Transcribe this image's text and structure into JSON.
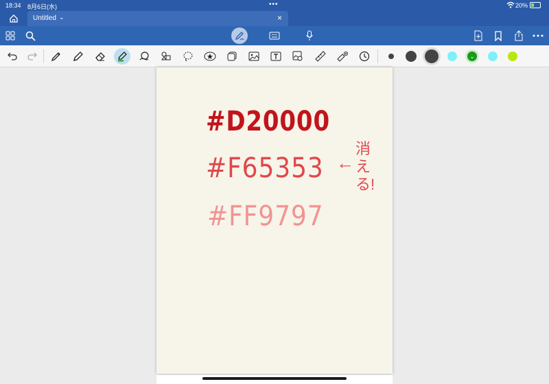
{
  "status": {
    "time": "18:34",
    "date": "8月6日(水)",
    "battery": "20%"
  },
  "tab": {
    "title": "Untitled"
  },
  "icons": {
    "home": "home-icon",
    "grid": "grid-icon",
    "search": "search-icon",
    "pen_mode": "pen-mode-icon",
    "keyboard": "keyboard-icon",
    "mic": "microphone-icon",
    "add_page": "add-page-icon",
    "bookmark": "bookmark-icon",
    "share": "share-icon",
    "more": "more-icon"
  },
  "tools": [
    "undo",
    "redo",
    "pen",
    "pencil",
    "eraser",
    "highlighter",
    "shape",
    "sticker",
    "lasso",
    "favorite",
    "element",
    "image",
    "textbox",
    "camera",
    "ruler",
    "laser",
    "timer"
  ],
  "swatches": [
    {
      "name": "size-small",
      "color": "#444444"
    },
    {
      "name": "size-medium",
      "color": "#444444"
    },
    {
      "name": "size-large",
      "color": "#444444"
    },
    {
      "name": "color-cyan",
      "color": "#7ff0f8"
    },
    {
      "name": "color-green",
      "color": "#1a9a1a"
    },
    {
      "name": "color-light-cyan",
      "color": "#7ff0f8"
    },
    {
      "name": "color-lime",
      "color": "#b8e810"
    }
  ],
  "canvas": {
    "line1": "#D20000",
    "line2": "#F65353",
    "line3": "#FF9797",
    "arrow": "←",
    "note": "消える!"
  }
}
